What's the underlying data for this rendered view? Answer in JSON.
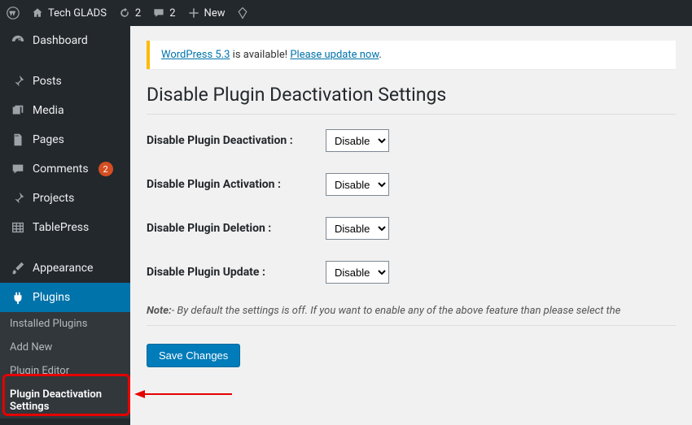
{
  "adminBar": {
    "siteName": "Tech GLADS",
    "updates": "2",
    "comments": "2",
    "newLabel": "New"
  },
  "sidebar": {
    "dashboard": "Dashboard",
    "posts": "Posts",
    "media": "Media",
    "pages": "Pages",
    "comments": "Comments",
    "commentsCount": "2",
    "projects": "Projects",
    "tablepress": "TablePress",
    "appearance": "Appearance",
    "plugins": "Plugins",
    "submenu": {
      "installed": "Installed Plugins",
      "addnew": "Add New",
      "editor": "Plugin Editor",
      "deact": "Plugin Deactivation Settings"
    }
  },
  "notice": {
    "linkA": "WordPress 5.3",
    "between": " is available! ",
    "linkB": "Please update now",
    "end": "."
  },
  "page": {
    "title": "Disable Plugin Deactivation Settings",
    "rows": [
      {
        "label": "Disable Plugin Deactivation :",
        "value": "Disable"
      },
      {
        "label": "Disable Plugin Activation :",
        "value": "Disable"
      },
      {
        "label": "Disable Plugin Deletion :",
        "value": "Disable"
      },
      {
        "label": "Disable Plugin Update :",
        "value": "Disable"
      }
    ],
    "noteLabel": "Note:",
    "noteText": "- By default the settings is off. If you want to enable any of the above feature than please select the",
    "saveLabel": "Save Changes"
  }
}
